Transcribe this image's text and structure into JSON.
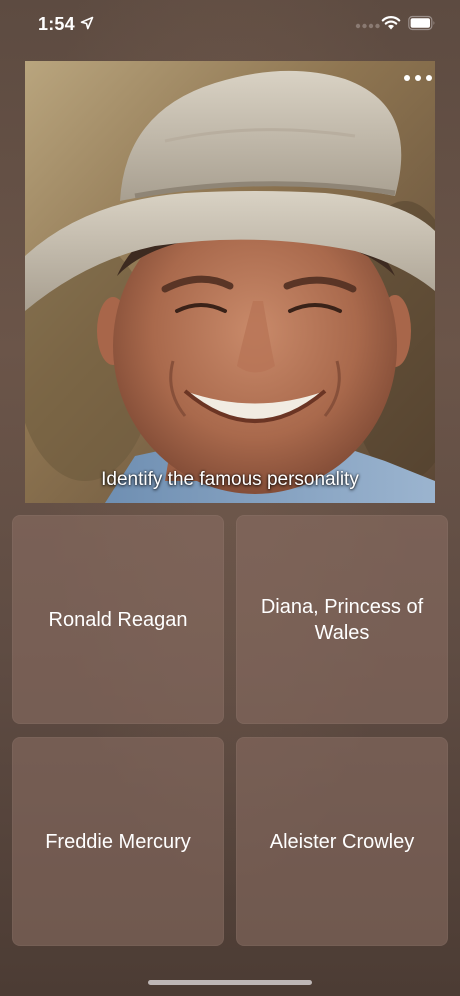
{
  "status_bar": {
    "time": "1:54"
  },
  "quiz": {
    "question": "Identify the famous personality",
    "answers": [
      "Ronald Reagan",
      "Diana, Princess of Wales",
      "Freddie Mercury",
      "Aleister Crowley"
    ]
  },
  "icons": {
    "location": "location-arrow-icon",
    "signal": "cellular-signal-icon",
    "wifi": "wifi-icon",
    "battery": "battery-icon",
    "more": "more-options-icon"
  }
}
